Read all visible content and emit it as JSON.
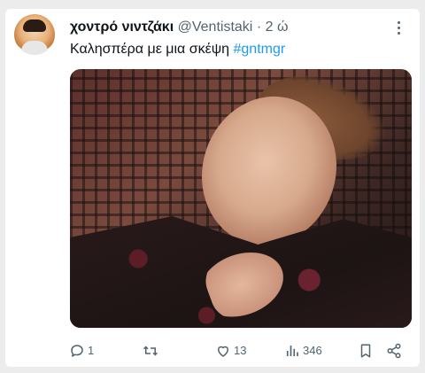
{
  "tweet": {
    "display_name": "χοντρό νιντζάκι",
    "handle": "@Ventistaki",
    "separator": "·",
    "time": "2 ώ",
    "text": "Καλησπέρα με μια σκέψη",
    "hashtag": "#gntmgr"
  },
  "actions": {
    "reply_count": "1",
    "retweet_count": "",
    "like_count": "13",
    "view_count": "346"
  },
  "icons": {
    "more": "more-options-icon",
    "reply": "reply-icon",
    "retweet": "retweet-icon",
    "like": "heart-icon",
    "views": "views-icon",
    "bookmark": "bookmark-icon",
    "share": "share-icon"
  },
  "colors": {
    "accent": "#1d9bf0",
    "text": "#0f1419",
    "muted": "#536471"
  }
}
